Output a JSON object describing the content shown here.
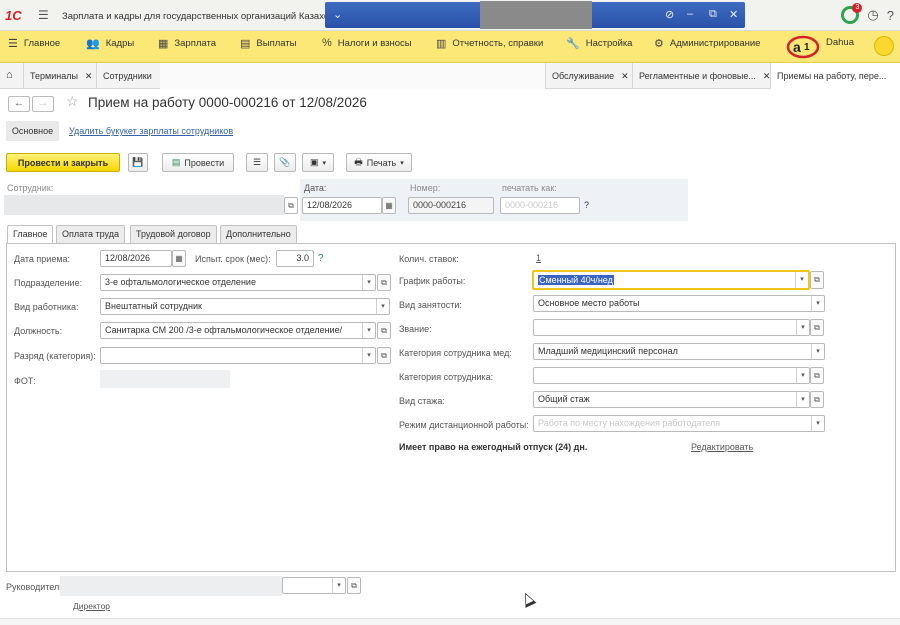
{
  "titlebar": {
    "app_logo": "1С",
    "title": "Зарплата и кадры для государственных организаций Казахстана",
    "notification_count": "3"
  },
  "main_menu": [
    {
      "icon": "hamburger-icon",
      "label": "Главное"
    },
    {
      "icon": "people-icon",
      "label": "Кадры"
    },
    {
      "icon": "calculator-icon",
      "label": "Зарплата"
    },
    {
      "icon": "coins-icon",
      "label": "Выплаты"
    },
    {
      "icon": "percent-icon",
      "label": "Налоги и взносы"
    },
    {
      "icon": "reports-icon",
      "label": "Отчетность, справки"
    },
    {
      "icon": "wrench-icon",
      "label": "Настройка"
    },
    {
      "icon": "gear-icon",
      "label": "Администрирование"
    }
  ],
  "user": {
    "company_logo": "a1",
    "name": "Dahua"
  },
  "open_tabs": [
    {
      "label": "Терминалы"
    },
    {
      "label": "Сотрудники"
    },
    {
      "label": "Обслуживание"
    },
    {
      "label": "Регламентные и фоновые..."
    },
    {
      "label": "Приемы на работу, пере..."
    }
  ],
  "form": {
    "title": "Прием на работу 0000-000216 от 12/08/2026",
    "section_main": "Основное",
    "delete_bookmark_link": "Удалить букукет зарплаты сотрудников",
    "commands": {
      "post_and_close": "Провести и закрыть",
      "post": "Провести",
      "print": "Печать"
    },
    "header": {
      "employee_label": "Сотрудник:",
      "date_label": "Дата:",
      "date_value": "12/08/2026",
      "number_label": "Номер:",
      "number_value": "0000-000216",
      "print_as_label": "печатать как:",
      "print_as_placeholder": "0000-000216",
      "help": "?"
    },
    "tabs": [
      "Главное",
      "Оплата труда",
      "Трудовой договор",
      "Дополнительно"
    ],
    "left": {
      "hire_date_label": "Дата приема:",
      "hire_date_value": "12/08/2026",
      "probation_label": "Испыт. срок (мес):",
      "probation_value": "3.0",
      "help": "?",
      "department_label": "Подразделение:",
      "department_value": "3-е офтальмологическое отделение",
      "employee_type_label": "Вид работника:",
      "employee_type_value": "Внештатный сотрудник",
      "position_label": "Должность:",
      "position_value": "Санитарка СМ 200 /3-е офтальмологическое отделение/",
      "grade_label": "Разряд (категория):",
      "grade_value": "",
      "fot_label": "ФОТ:"
    },
    "right": {
      "rates_label": "Колич. ставок:",
      "rates_value": "1",
      "schedule_label": "График работы:",
      "schedule_value": "Сменный 40ч/нед",
      "employment_type_label": "Вид занятости:",
      "employment_type_value": "Основное место работы",
      "rank_label": "Звание:",
      "rank_value": "",
      "med_category_label": "Категория сотрудника мед:",
      "med_category_value": "Младший медицинский персонал",
      "category_label": "Категория сотрудника:",
      "category_value": "",
      "seniority_type_label": "Вид стажа:",
      "seniority_type_value": "Общий стаж",
      "remote_mode_label": "Режим дистанционной работы:",
      "remote_mode_value": "Работа по месту нахождения работодателя",
      "vacation_note": "Имеет право на ежегодный отпуск (24) дн.",
      "edit_link": "Редактировать"
    },
    "footer": {
      "manager_label": "Руководитель:",
      "manager_position_link": "Директор"
    }
  }
}
